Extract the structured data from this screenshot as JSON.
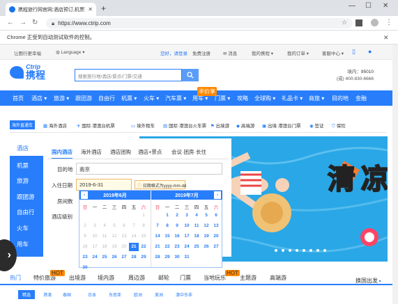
{
  "browser": {
    "tab_title": "携程旅行网官网:酒店预订,机票预",
    "url": "https://www.ctrip.com",
    "infobar": "Chrome 正受到自动测试软件的控制。"
  },
  "topstrip": {
    "items": [
      "让图行更幸福",
      "Language",
      "您好，请登录",
      "免费注册",
      "消息",
      "我的携程",
      "我的订单",
      "客服中心"
    ]
  },
  "header": {
    "logo_en": "Ctrip",
    "logo_cn": "携程",
    "search_placeholder": "搜索旅行地/酒店/景点/门票/交通",
    "hotline_label": "境内：",
    "hotline_domestic": "95010",
    "hotline_intl_label": "(或) 400-830-6666"
  },
  "mainnav": {
    "items": [
      "首页",
      "酒店",
      "旅游",
      "跟团游",
      "自由行",
      "机票",
      "火车",
      "汽车票",
      "用车",
      "门票",
      "攻略",
      "全球购",
      "礼品卡",
      "商旅",
      "目的地",
      "金融"
    ],
    "badge": "半价享"
  },
  "subbar": {
    "tag": "海外直通车",
    "items": [
      "海外酒店",
      "国际·港澳台机票",
      "境外租车",
      "国际·港澳台火车票",
      "出境游",
      "高端游",
      "出境·港澳台门票",
      "签证",
      "保险"
    ]
  },
  "sidenav": {
    "items": [
      "酒店",
      "机票",
      "旅游",
      "跟团游",
      "自由行",
      "火车",
      "用车"
    ]
  },
  "panel": {
    "tabs": [
      "国内酒店",
      "海外酒店",
      "酒店团购",
      "酒店+景点",
      "会议·团房·长住"
    ],
    "dest_label": "目的地",
    "dest_value": "南京",
    "checkin_label": "入住日期",
    "checkin_value": "2019-6-31",
    "tip": "日期格式为yyyy-mm-dd",
    "rooms_label": "房间数",
    "level_label": "酒店级别"
  },
  "calendar": {
    "left_title": "2019年6月",
    "right_title": "2019年7月",
    "weekdays": [
      "日",
      "一",
      "二",
      "三",
      "四",
      "五",
      "六"
    ]
  },
  "bottom": {
    "tabs": [
      "热门",
      "特价旅游",
      "出境游",
      "境内游",
      "周边游",
      "邮轮",
      "门票",
      "当地玩乐",
      "主题游",
      "高端游"
    ],
    "hot_badge": "HOT",
    "more": "换国出发",
    "chips": [
      "精选",
      "港澳",
      "泰国",
      "日本",
      "东南亚",
      "欧洲",
      "美洲",
      "澳中东非"
    ]
  },
  "colors": {
    "brand": "#287dfa",
    "accent": "#f80"
  }
}
